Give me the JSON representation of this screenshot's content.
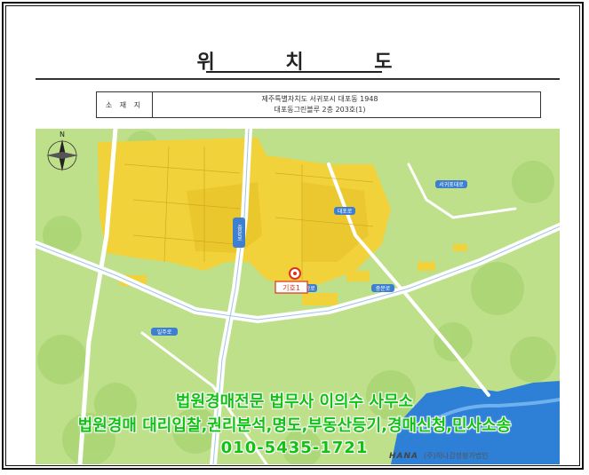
{
  "document": {
    "title": "위 치 도",
    "location_label": "소 재 지",
    "address_line1": "제주특별자치도 서귀포시 대포동 1948",
    "address_line2": "대포동그린블루 2층 203호(1)"
  },
  "map": {
    "north_label": "N",
    "marker_label": "기호1",
    "road_labels": [
      "중문로",
      "일주로",
      "중문관광로",
      "서귀포대로",
      "중문로",
      "대포로"
    ],
    "colors": {
      "urban": "#f2d23a",
      "forest": "#bfe08a",
      "water": "#2e7fd6",
      "road": "#ffffff",
      "marker": "#e03020"
    }
  },
  "overlay": {
    "line1": "법원경매전문 법무사 이의수 사무소",
    "line2": "법원경매 대리입찰,권리분석,명도,부동산등기,경매신청,민사소송",
    "line3": "010-5435-1721",
    "color": "#12c213"
  },
  "footer": {
    "logo_mark": "HANA",
    "logo_text": "(주)하나감정평가법인"
  }
}
